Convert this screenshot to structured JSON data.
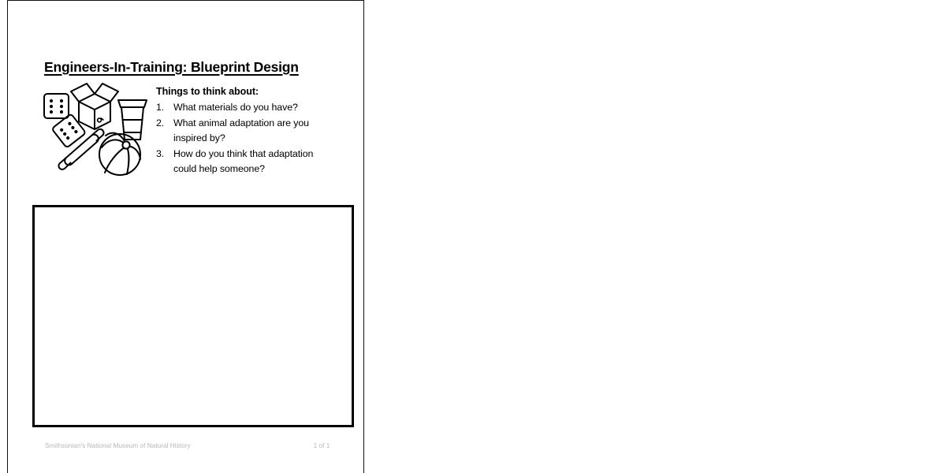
{
  "document": {
    "title": "Engineers-In-Training: Blueprint Design"
  },
  "prompt": {
    "heading": "Things to think about:",
    "items": [
      {
        "number": "1.",
        "text": "What materials do you have?"
      },
      {
        "number": "2.",
        "text": "What animal adaptation are you inspired by?"
      },
      {
        "number": "3.",
        "text": "How do you think that adaptation could help someone?"
      }
    ]
  },
  "illustration": {
    "caption": "",
    "items": [
      "die-icon",
      "die-tilted-icon",
      "open-cardboard-box-icon",
      "takeaway-coffee-cup-icon",
      "rolling-pin-icon",
      "beach-ball-icon"
    ]
  },
  "drawing_area": {
    "label": ""
  },
  "footer": {
    "credit": "Smithsonian's National Museum of Natural History",
    "pagination": "1 of 1"
  },
  "colors": {
    "ink": "#000000",
    "page_border": "#111111",
    "footer_text": "#b7b7b7",
    "page_background": "#ffffff"
  }
}
